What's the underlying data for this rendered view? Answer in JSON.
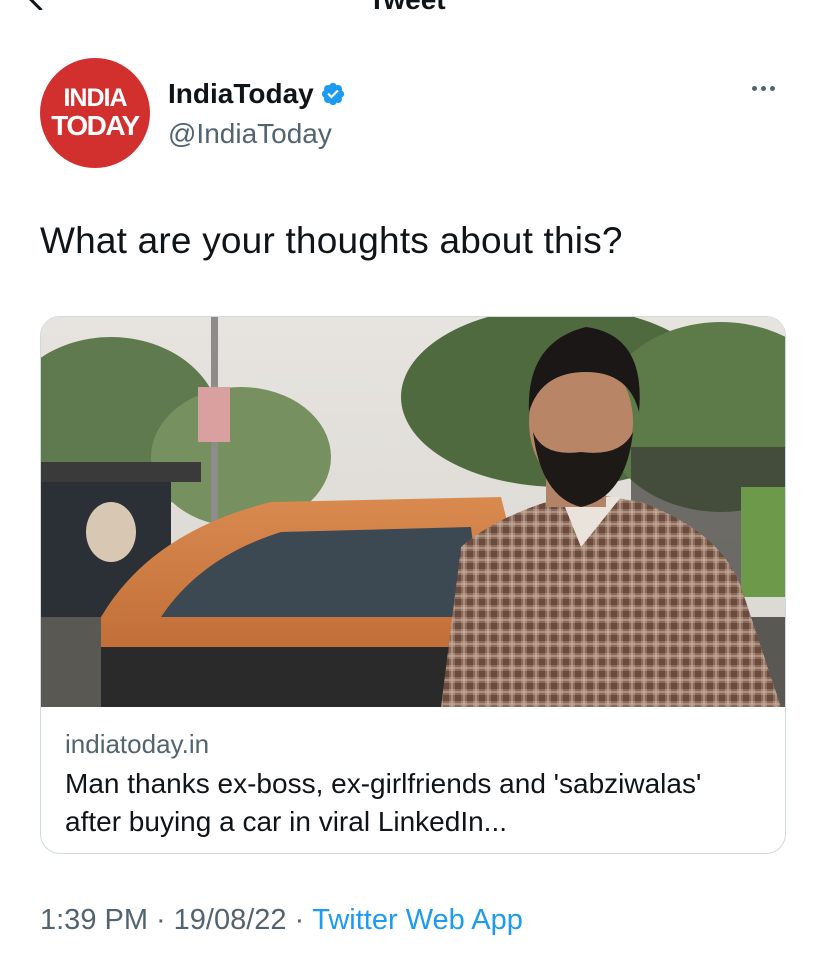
{
  "header": {
    "title": "Tweet"
  },
  "author": {
    "avatar_line1": "INDIA",
    "avatar_line2": "TODAY",
    "display_name": "IndiaToday",
    "handle": "@IndiaToday",
    "verified": true
  },
  "tweet": {
    "text": "What are your thoughts about this?"
  },
  "link_card": {
    "domain": "indiatoday.in",
    "title": "Man thanks ex-boss, ex-girlfriends and 'sabziwalas' after buying a car in viral LinkedIn..."
  },
  "meta": {
    "time": "1:39 PM",
    "separator": "·",
    "date": "19/08/22",
    "source": "Twitter Web App"
  },
  "colors": {
    "accent": "#1d9bf0",
    "avatar_bg": "#d2302f",
    "secondary_text": "#536471"
  },
  "icons": [
    "back-arrow-icon",
    "verified-badge-icon",
    "more-options-icon"
  ]
}
